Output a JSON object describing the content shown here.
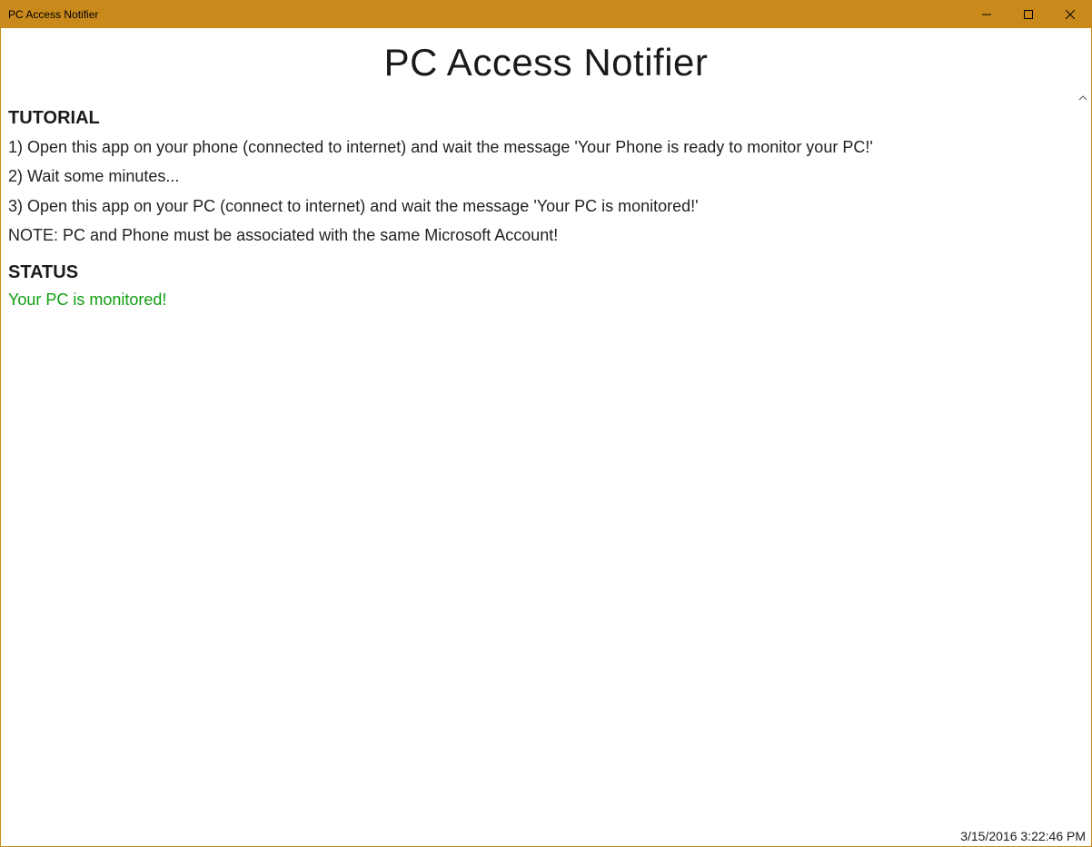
{
  "window": {
    "title": "PC Access Notifier"
  },
  "header": {
    "app_title": "PC Access Notifier"
  },
  "tutorial": {
    "heading": "TUTORIAL",
    "step1": "1) Open this app on your phone (connected to internet) and wait the message 'Your Phone is ready to monitor your PC!'",
    "step2": "2) Wait some minutes...",
    "step3": "3) Open this app on your PC (connect to internet) and wait the message 'Your PC is monitored!'",
    "note": "NOTE: PC and Phone must be associated with the same Microsoft Account!"
  },
  "status": {
    "heading": "STATUS",
    "message": "Your PC is monitored!",
    "color": "#109e10"
  },
  "footer": {
    "datetime": "3/15/2016 3:22:46 PM"
  },
  "colors": {
    "titlebar": "#c98a1b"
  }
}
